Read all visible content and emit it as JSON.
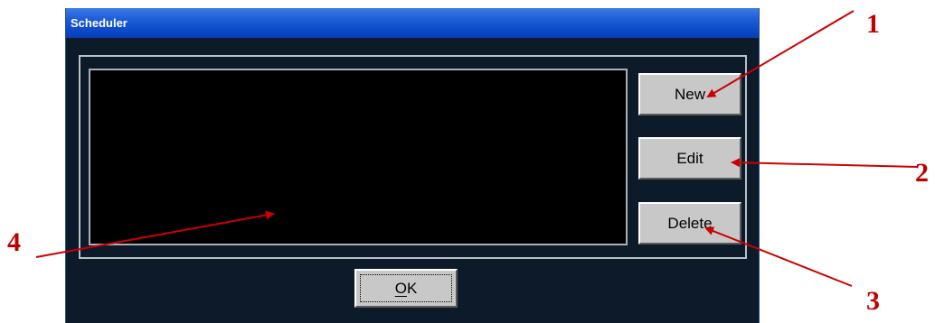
{
  "window": {
    "title": "Scheduler"
  },
  "buttons": {
    "new_label": "New",
    "edit_label": "Edit",
    "delete_label": "Delete",
    "ok_label_mnemonic": "O",
    "ok_label_rest": "K"
  },
  "callouts": [
    "1",
    "2",
    "3",
    "4"
  ],
  "colors": {
    "titlebar": "#0a46c6",
    "window_bg": "#0c1a2a",
    "list_bg": "#000000",
    "button_face": "#c8c8c8",
    "callout": "#cc0000"
  }
}
